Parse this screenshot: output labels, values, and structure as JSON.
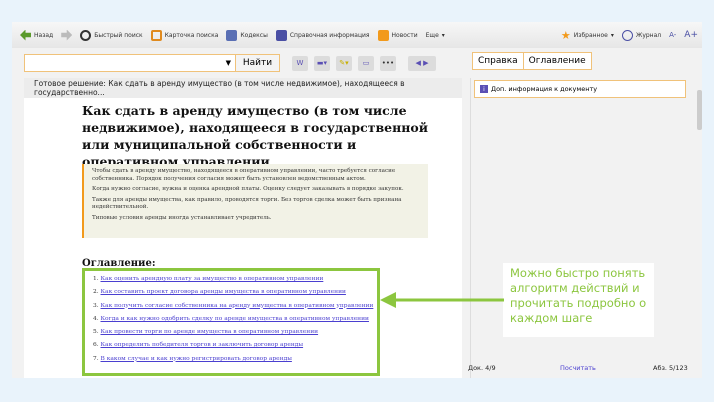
{
  "toolbar": {
    "back": "Назад",
    "quick_search": "Быстрый поиск",
    "search_card": "Карточка поиска",
    "codes": "Кодексы",
    "reference": "Справочная информация",
    "news": "Новости",
    "more": "Еще",
    "favorites": "Избранное",
    "journal": "Журнал",
    "font_smaller": "A-",
    "font_larger": "A+"
  },
  "search": {
    "value": "",
    "find": "Найти"
  },
  "tabs": [
    "Справка",
    "Оглавление"
  ],
  "doc_header": "Готовое решение: Как сдать в аренду имущество (в том числе недвижимое), находящееся в государственно...",
  "title": "Как сдать в аренду имущество (в том числе недвижимое), находящееся в государственной или муниципальной собственности и оперативном управлении",
  "note": [
    "Чтобы сдать в аренду имущество, находящееся в оперативном управлении, часто требуется согласие собственника. Порядок получения согласия может быть установлен ведомственным актом.",
    "Когда нужно согласие, нужна и оценка арендной платы. Оценку следует заказывать в порядке закупок.",
    "Также для аренды имущества, как правило, проводятся торги. Без торгов сделка может быть признана недействительной.",
    "Типовые условия аренды иногда устанавливает учредитель."
  ],
  "toc_title": "Оглавление:",
  "toc": [
    "Как оценить арендную плату за имущество в оперативном управлении",
    "Как составить проект договора аренды имущества в оперативном управлении",
    "Как получить согласие собственника на аренду имущества в оперативном управлении",
    "Когда и как нужно одобрить сделку по аренде имущества в оперативном управлении",
    "Как провести торги по аренде имущества в оперативном управлении",
    "Как определить победителя торгов и заключить договор аренды",
    "В каком случае и как нужно регистрировать договор аренды"
  ],
  "right_panel": {
    "dop_info": "Доп. информация к документу"
  },
  "callout": "Можно быстро понять алгоритм действий и прочитать подробно о каждом шаге",
  "footer": {
    "doc": "Док. 4/9",
    "count": "Посчитать",
    "para": "Абз. 5/123"
  },
  "colors": {
    "accent": "#8cc63f",
    "border": "#f0c27a",
    "link": "#4a3fd0"
  }
}
